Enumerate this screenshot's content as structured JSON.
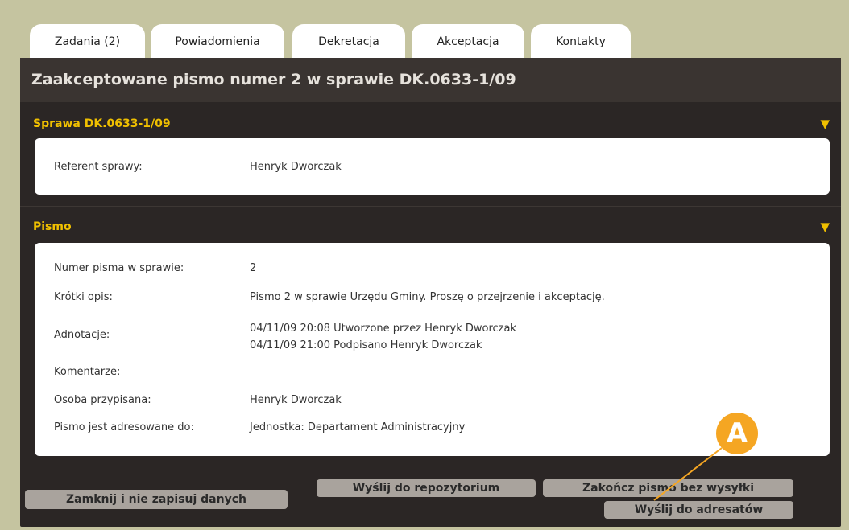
{
  "tabs": [
    {
      "label": "Zadania (2)"
    },
    {
      "label": "Powiadomienia"
    },
    {
      "label": "Dekretacja"
    },
    {
      "label": "Akceptacja"
    },
    {
      "label": "Kontakty"
    }
  ],
  "title": "Zaakceptowane pismo numer 2 w sprawie DK.0633-1/09",
  "sprawa": {
    "header": "Sprawa DK.0633-1/09",
    "toggle_icon": "triangle-down-icon",
    "rows": [
      {
        "label": "Referent sprawy:",
        "value": "Henryk Dworczak"
      }
    ]
  },
  "pismo": {
    "header": "Pismo",
    "toggle_icon": "triangle-down-icon",
    "rows": [
      {
        "label": "Numer pisma w sprawie:",
        "value": "2"
      },
      {
        "label": "Krótki opis:",
        "value": "Pismo 2 w sprawie Urzędu Gminy. Proszę o przejrzenie i akceptację."
      },
      {
        "label": "Adnotacje:",
        "value": "04/11/09 20:08 Utworzone przez Henryk Dworczak",
        "value2": "04/11/09 21:00 Podpisano Henryk Dworczak"
      },
      {
        "label": "Komentarze:",
        "value": ""
      },
      {
        "label": "Osoba przypisana:",
        "value": "Henryk Dworczak"
      },
      {
        "label": "Pismo jest adresowane do:",
        "value": "Jednostka: Departament Administracyjny"
      }
    ]
  },
  "buttons": {
    "close": "Zamknij i nie zapisuj danych",
    "repo": "Wyślij do repozytorium",
    "finish": "Zakończ pismo bez wysyłki",
    "send": "Wyślij do adresatów"
  },
  "annotation": {
    "label": "A",
    "color": "#f5a623"
  }
}
